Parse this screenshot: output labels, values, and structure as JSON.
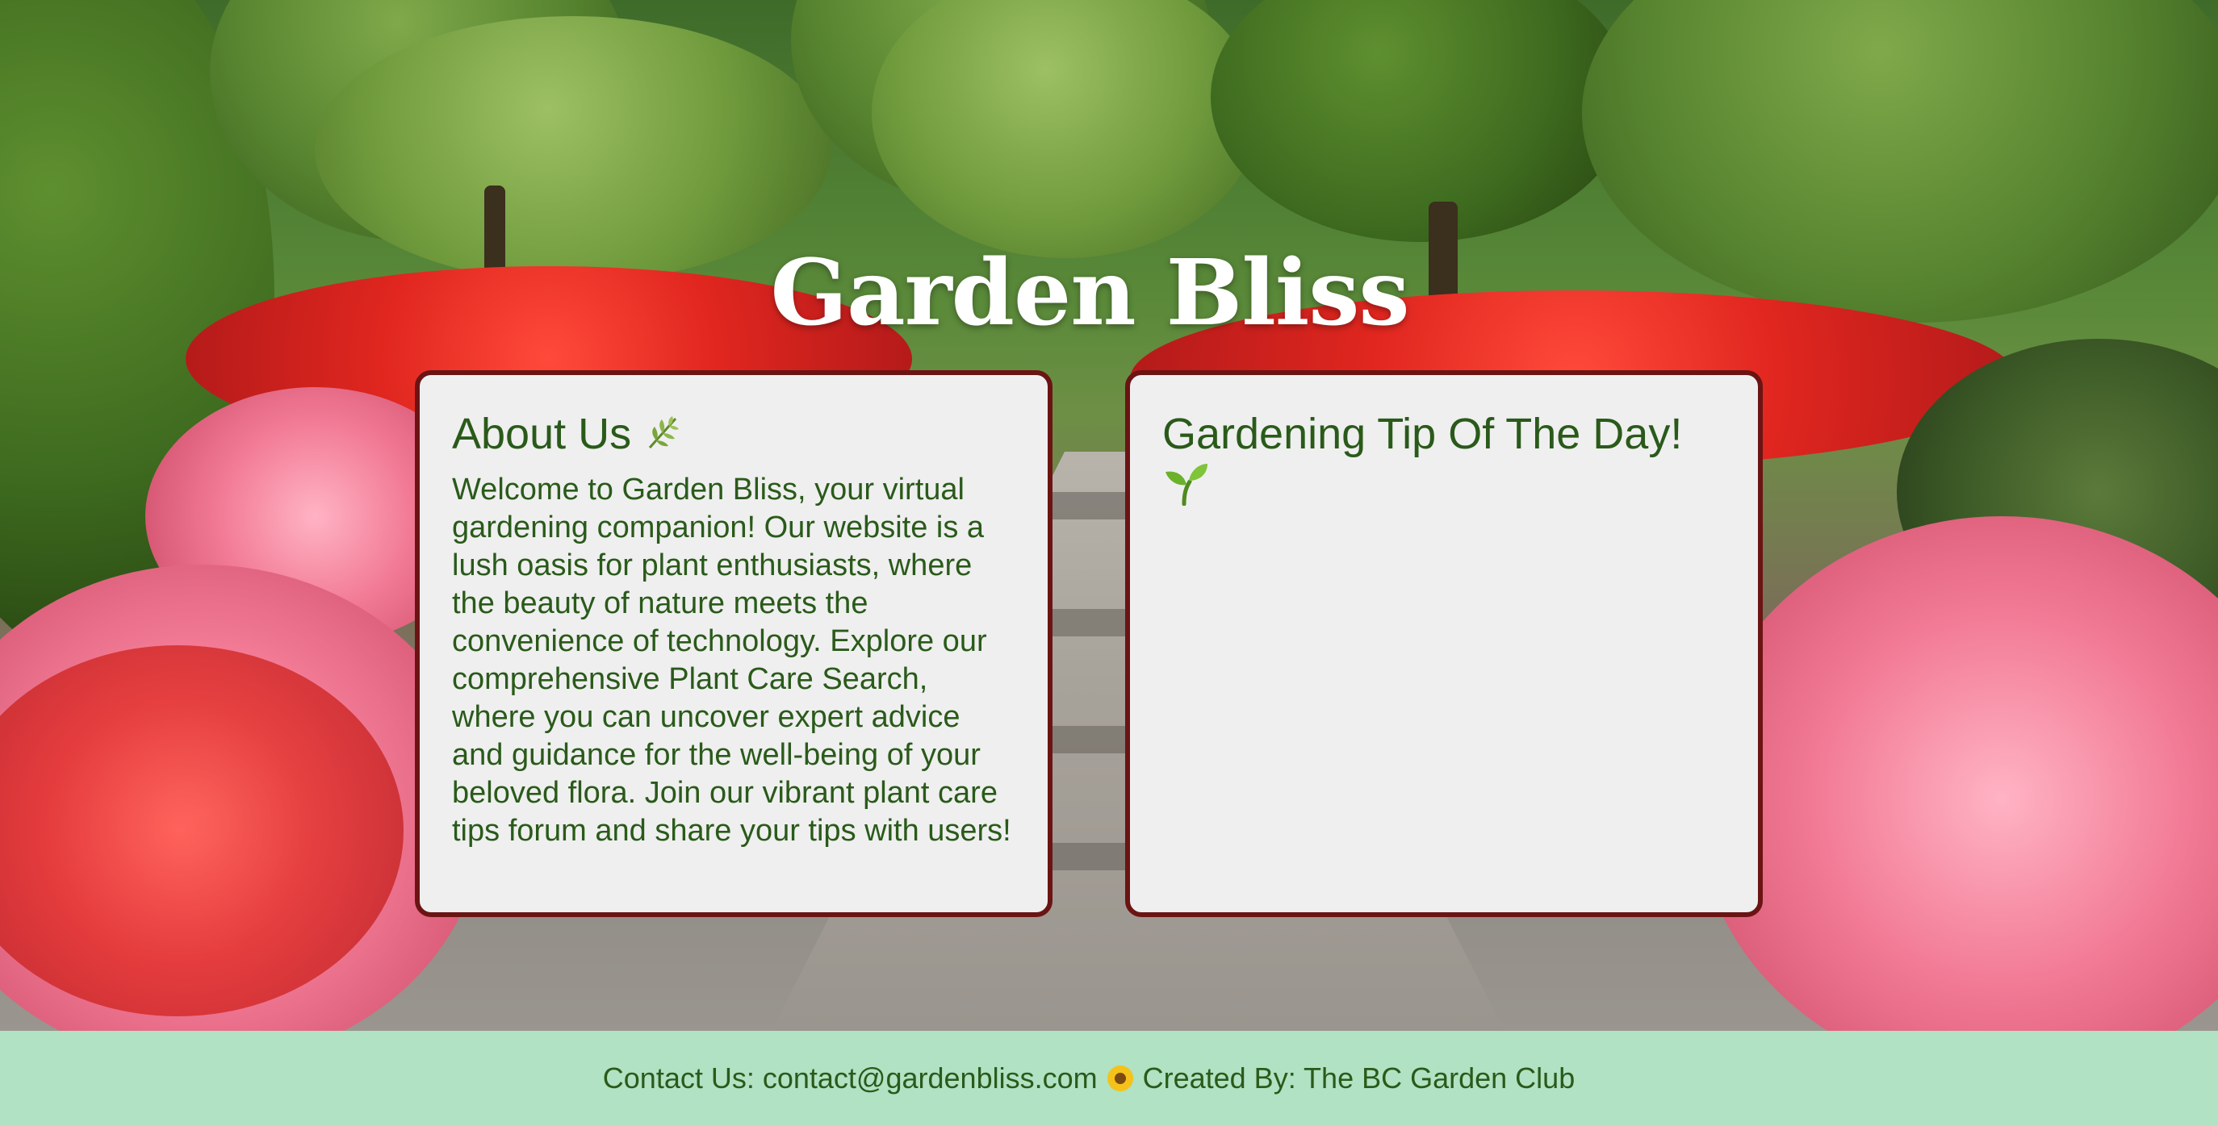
{
  "header": {
    "title": "Garden Bliss"
  },
  "about": {
    "heading": "About Us",
    "heading_icon": "herb-leaf-icon",
    "body": "Welcome to Garden Bliss, your virtual gardening companion! Our website is a lush oasis for plant enthusiasts, where the beauty of nature meets the convenience of technology. Explore our comprehensive Plant Care Search, where you can uncover expert advice and guidance for the well-being of your beloved flora. Join our vibrant plant care tips forum and share your tips with users!"
  },
  "tip": {
    "heading": "Gardening Tip Of The Day!",
    "heading_icon": "seedling-icon"
  },
  "footer": {
    "contact_label": "Contact Us: ",
    "contact_email": "contact@gardenbliss.com",
    "separator_icon": "sunflower-icon",
    "created_by": "Created By: The BC Garden Club"
  },
  "colors": {
    "card_background": "#efefef",
    "card_border": "#6b1414",
    "text_green": "#2a5a1a",
    "footer_background": "#b0e2c3",
    "title_color": "#ffffff"
  }
}
